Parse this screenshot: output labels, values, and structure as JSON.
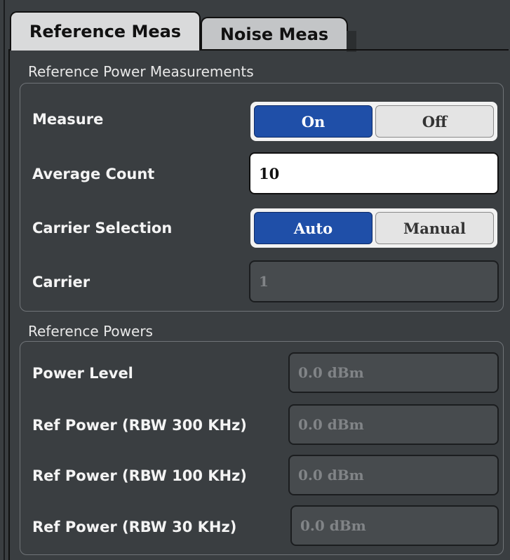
{
  "tabs": [
    {
      "label": "Reference Meas",
      "active": true
    },
    {
      "label": "Noise Meas",
      "active": false
    }
  ],
  "reference_power_measurements": {
    "title": "Reference Power Measurements",
    "measure": {
      "label": "Measure",
      "on": "On",
      "off": "Off",
      "selected": "On"
    },
    "average_count": {
      "label": "Average Count",
      "value": "10"
    },
    "carrier_selection": {
      "label": "Carrier Selection",
      "auto": "Auto",
      "manual": "Manual",
      "selected": "Auto"
    },
    "carrier": {
      "label": "Carrier",
      "value": "1"
    }
  },
  "reference_powers": {
    "title": "Reference Powers",
    "power_level": {
      "label": "Power Level",
      "value": "0.0 dBm"
    },
    "ref_power_300": {
      "label": "Ref Power (RBW 300 KHz)",
      "value": "0.0 dBm"
    },
    "ref_power_100": {
      "label": "Ref Power (RBW 100 KHz)",
      "value": "0.0 dBm"
    },
    "ref_power_30": {
      "label": "Ref Power (RBW 30 KHz)",
      "value": "0.0 dBm"
    }
  },
  "colors": {
    "background": "#3a3e41",
    "accent_selected": "#1f4fa8",
    "tab_active": "#d9dadb",
    "tab_inactive": "#c3c5c7"
  }
}
